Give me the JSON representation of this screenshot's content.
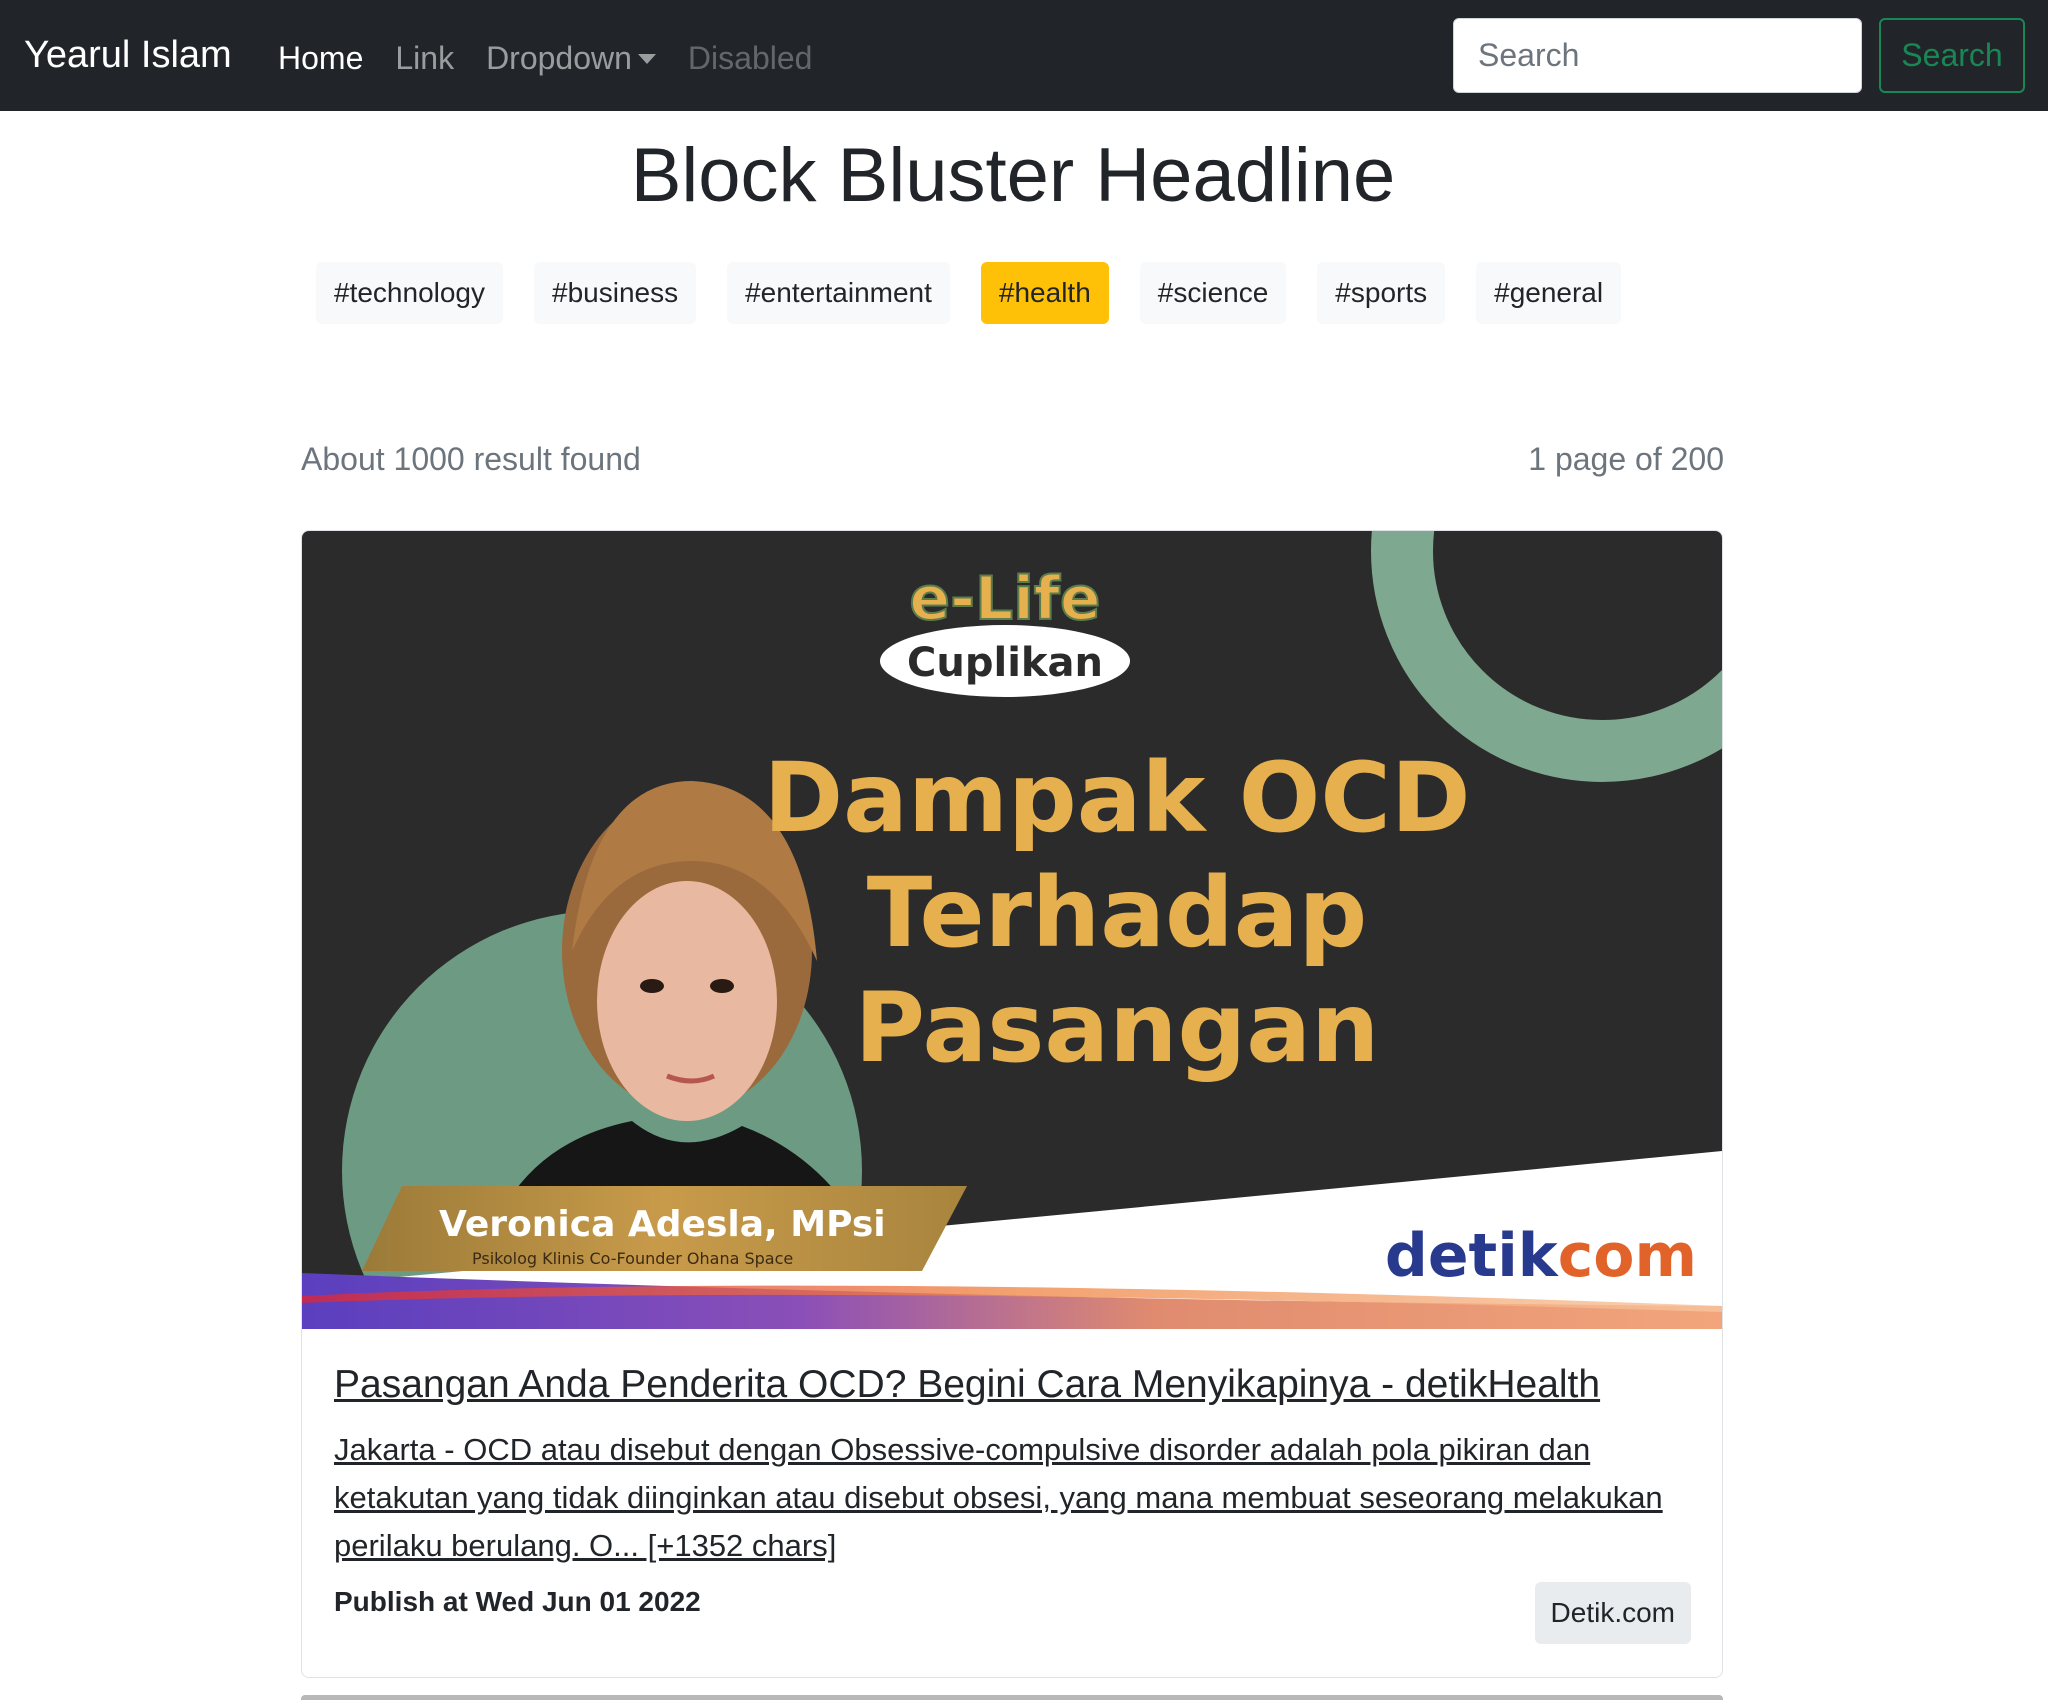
{
  "navbar": {
    "brand": "Yearul Islam",
    "links": [
      {
        "label": "Home",
        "state": "active"
      },
      {
        "label": "Link",
        "state": "normal"
      },
      {
        "label": "Dropdown",
        "state": "dropdown"
      },
      {
        "label": "Disabled",
        "state": "disabled"
      }
    ],
    "search_placeholder": "Search",
    "search_button": "Search"
  },
  "headline": "Block Bluster Headline",
  "tags": [
    {
      "label": "#technology",
      "active": false
    },
    {
      "label": "#business",
      "active": false
    },
    {
      "label": "#entertainment",
      "active": false
    },
    {
      "label": "#health",
      "active": true
    },
    {
      "label": "#science",
      "active": false
    },
    {
      "label": "#sports",
      "active": false
    },
    {
      "label": "#general",
      "active": false
    }
  ],
  "results": {
    "count_text": "About 1000 result found",
    "page_text": "1 page of 200"
  },
  "article": {
    "image": {
      "logo_top": "e-Life",
      "logo_bottom": "Cuplikan",
      "headline_lines": [
        "Dampak OCD",
        "Terhadap",
        "Pasangan"
      ],
      "person_name": "Veronica Adesla, MPsi",
      "person_role": "Psikolog Klinis Co-Founder Ohana Space",
      "brand_main": "detik",
      "brand_suffix": "com"
    },
    "title": "Pasangan Anda Penderita OCD? Begini Cara Menyikapinya - detikHealth",
    "description": "Jakarta - OCD atau disebut dengan Obsessive-compulsive disorder adalah pola pikiran dan ketakutan yang tidak diinginkan atau disebut obsesi, yang mana membuat seseorang melakukan perilaku berulang. O... [+1352 chars]",
    "published": "Publish at Wed Jun 01 2022",
    "source": "Detik.com"
  },
  "colors": {
    "navbar_bg": "#212529",
    "success": "#198754",
    "warning": "#ffc107",
    "image_bg": "#2b2b2b",
    "image_accent_green": "#7ea88f",
    "image_text_gold": "#e6b04f",
    "detik_blue": "#283a8e",
    "detik_orange": "#e2632a"
  }
}
